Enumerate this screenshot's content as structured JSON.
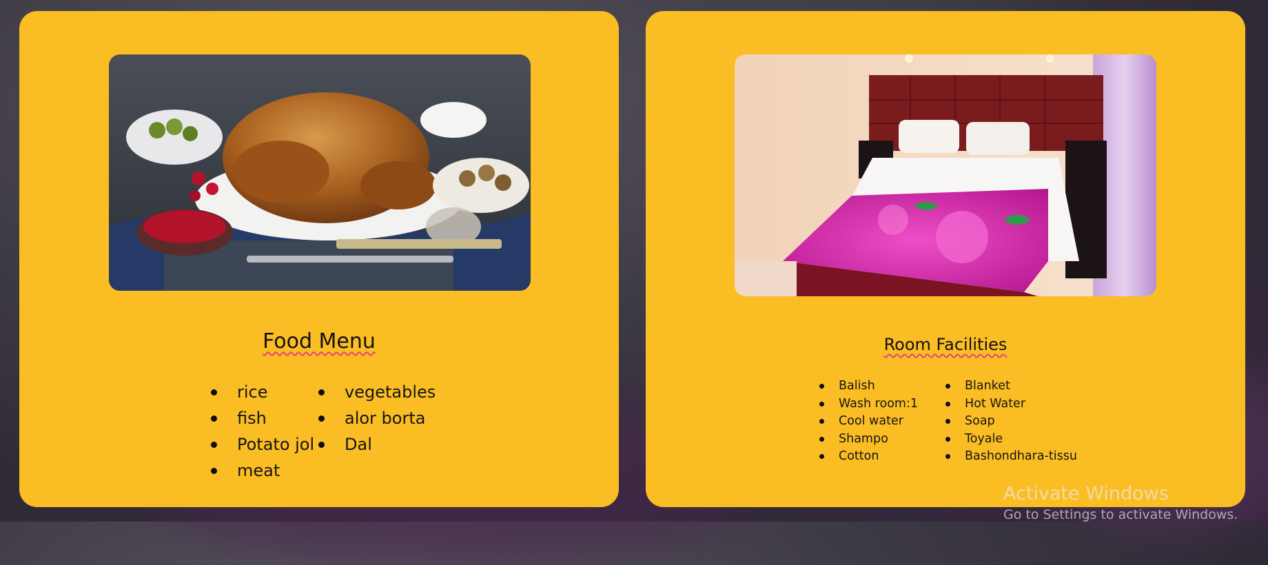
{
  "food_card": {
    "title": "Food Menu",
    "photo_icon": "roast-turkey-photo",
    "items_col1": [
      "rice",
      "fish",
      "Potato jol",
      "meat"
    ],
    "items_col2": [
      "vegetables",
      "alor borta",
      "Dal"
    ]
  },
  "room_card": {
    "title": "Room Facilities",
    "photo_icon": "hotel-bed-photo",
    "items_col1": [
      "Balish",
      "Wash room:1",
      "Cool water",
      "Shampo",
      "Cotton"
    ],
    "items_col2": [
      "Blanket",
      "Hot Water",
      "Soap",
      "Toyale",
      "Bashondhara-tissu"
    ]
  },
  "watermark": {
    "title": "Activate Windows",
    "subtitle": "Go to Settings to activate Windows."
  },
  "colors": {
    "card_background": "#fbbd24",
    "underline": "#e0457b"
  }
}
